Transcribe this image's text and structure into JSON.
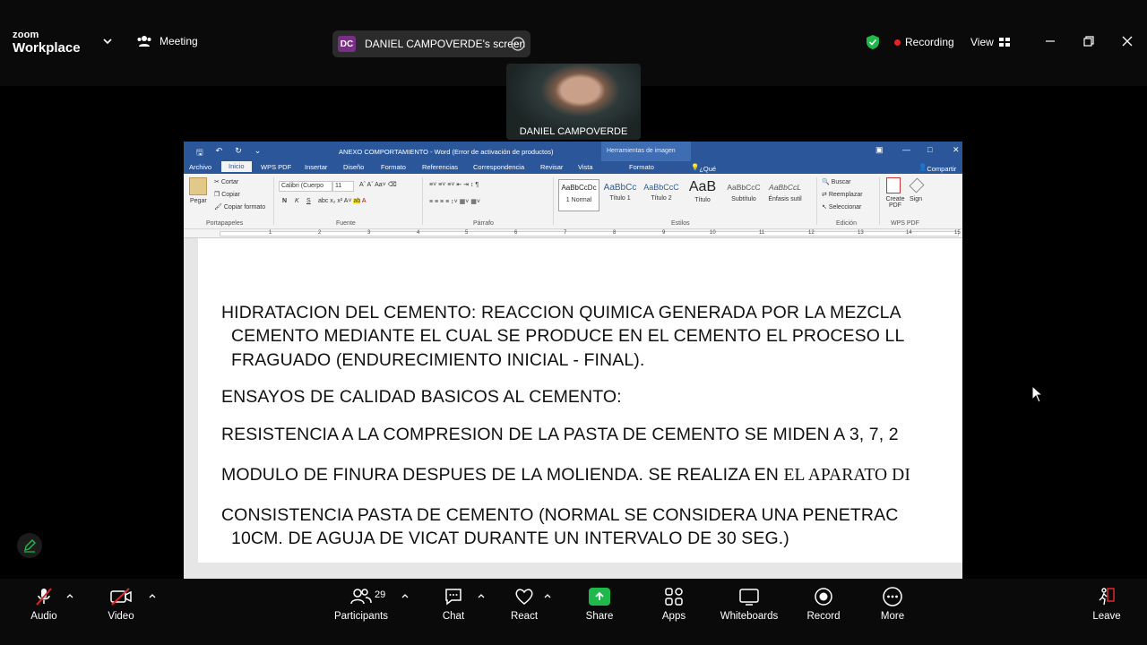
{
  "app": {
    "logo_top": "zoom",
    "logo_bottom": "Workplace",
    "meeting_label": "Meeting",
    "share_initials": "DC",
    "share_label": "DANIEL CAMPOVERDE's screen",
    "recording_label": "Recording",
    "view_label": "View",
    "accent_green": "#1fb84b",
    "record_red": "#e0262c"
  },
  "participant": {
    "name": "DANIEL CAMPOVERDE"
  },
  "word": {
    "title": "ANEXO COMPORTAMIENTO - Word (Error de activación de productos)",
    "image_tools": "Herramientas de imagen",
    "tabs": [
      "Archivo",
      "Inicio",
      "WPS PDF",
      "Insertar",
      "Diseño",
      "Formato",
      "Referencias",
      "Correspondencia",
      "Revisar",
      "Vista",
      "Formato"
    ],
    "tell_me": "¿Qué desea hacer?",
    "share": "Compartir",
    "clipboard": {
      "paste": "Pegar",
      "cut": "Cortar",
      "copy": "Copiar",
      "format_painter": "Copiar formato",
      "group": "Portapapeles"
    },
    "font": {
      "name": "Calibri (Cuerpo",
      "size": "11",
      "group": "Fuente"
    },
    "paragraph_group": "Párrafo",
    "styles": [
      {
        "preview": "AaBbCcDc",
        "name": "1 Normal"
      },
      {
        "preview": "AaBbCc",
        "name": "Título 1"
      },
      {
        "preview": "AaBbCcC",
        "name": "Título 2"
      },
      {
        "preview": "AaB",
        "name": "Título"
      },
      {
        "preview": "AaBbCcC",
        "name": "Subtítulo"
      },
      {
        "preview": "AaBbCcL",
        "name": "Énfasis sutil"
      }
    ],
    "styles_group": "Estilos",
    "editing": {
      "find": "Buscar",
      "replace": "Reemplazar",
      "select": "Seleccionar",
      "group": "Edición"
    },
    "wps": {
      "create": "Create PDF",
      "sign": "Sign",
      "group": "WPS PDF"
    },
    "ruler": [
      "1",
      "2",
      "3",
      "4",
      "5",
      "6",
      "7",
      "8",
      "9",
      "10",
      "11",
      "12",
      "13",
      "14",
      "15"
    ],
    "lines": [
      "HIDRATACION DEL CEMENTO: REACCION QUIMICA GENERADA POR LA MEZCLA",
      "CEMENTO MEDIANTE EL CUAL SE PRODUCE EN EL CEMENTO EL PROCESO LL",
      "FRAGUADO (ENDURECIMIENTO INICIAL - FINAL).",
      "ENSAYOS DE CALIDAD BASICOS AL CEMENTO:",
      "RESISTENCIA A LA COMPRESION DE LA PASTA DE CEMENTO SE MIDEN A 3, 7, 2",
      "MODULO DE FINURA DESPUES DE LA MOLIENDA. SE REALIZA EN ",
      "EL APARATO DI",
      "CONSISTENCIA PASTA DE CEMENTO (NORMAL SE CONSIDERA UNA PENETRAC",
      "10CM. DE AGUJA DE VICAT DURANTE UN INTERVALO DE 30 SEG.)"
    ]
  },
  "toolbar": {
    "audio": "Audio",
    "video": "Video",
    "participants": "Participants",
    "participants_count": "29",
    "chat": "Chat",
    "react": "React",
    "share": "Share",
    "apps": "Apps",
    "whiteboards": "Whiteboards",
    "record": "Record",
    "more": "More",
    "leave": "Leave"
  }
}
